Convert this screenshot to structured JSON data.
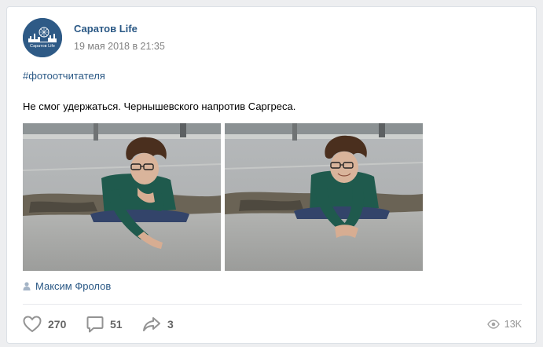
{
  "post": {
    "author": {
      "name": "Саратов Life",
      "avatar_text": "Саратов Life"
    },
    "date": "19 мая 2018 в 21:35",
    "hashtag": "#фотоотчитателя",
    "text": "Не смог удержаться. Чернышевского напротив Саргреса.",
    "photos": [
      {
        "name": "photo-1"
      },
      {
        "name": "photo-2"
      }
    ],
    "signer": {
      "name": "Максим Фролов",
      "icon": "user-icon"
    },
    "actions": {
      "likes": "270",
      "comments": "51",
      "shares": "3"
    },
    "views": "13K"
  },
  "colors": {
    "link": "#2a5885",
    "muted": "#828282",
    "action": "#656565",
    "icon": "#939393",
    "avatar_bg": "#2e5a86"
  }
}
